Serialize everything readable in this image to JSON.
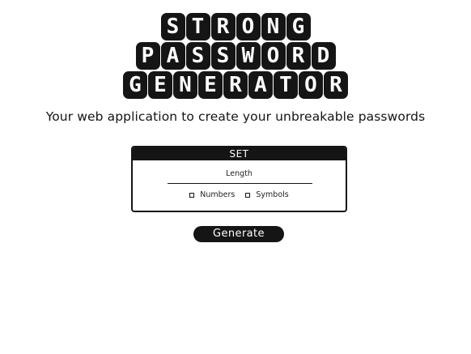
{
  "title": {
    "rows": [
      [
        "S",
        "T",
        "R",
        "O",
        "N",
        "G"
      ],
      [
        "P",
        "A",
        "S",
        "S",
        "W",
        "O",
        "R",
        "D"
      ],
      [
        "G",
        "E",
        "N",
        "E",
        "R",
        "A",
        "T",
        "O",
        "R"
      ]
    ]
  },
  "subtitle": "Your web application to create your unbreakable passwords",
  "panel": {
    "header": "SET",
    "length_label": "Length",
    "options": [
      {
        "label": "Numbers",
        "checked": false
      },
      {
        "label": "Symbols",
        "checked": false
      }
    ]
  },
  "generate_button": "Generate"
}
